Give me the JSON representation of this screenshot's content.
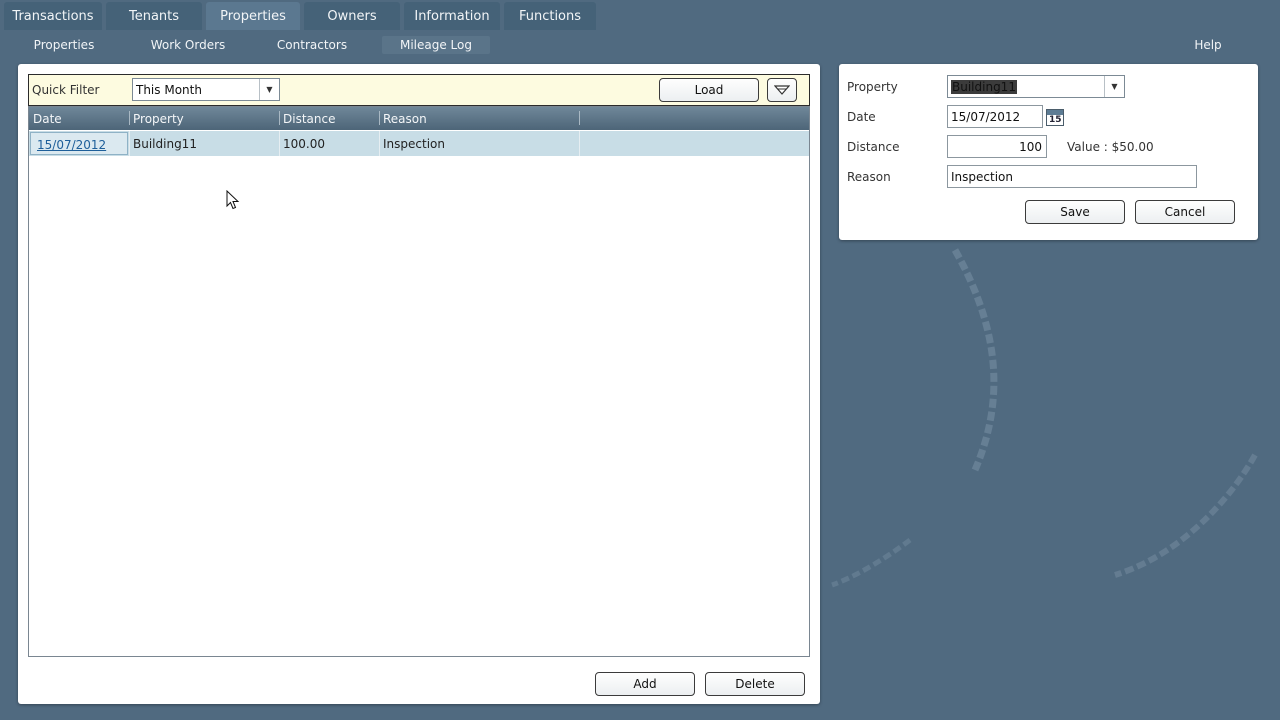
{
  "top_tabs": [
    "Transactions",
    "Tenants",
    "Properties",
    "Owners",
    "Information",
    "Functions"
  ],
  "sub_nav": {
    "items": [
      "Properties",
      "Work Orders",
      "Contractors",
      "Mileage Log"
    ],
    "help": "Help"
  },
  "filter": {
    "label": "Quick Filter",
    "value": "This Month",
    "load_label": "Load"
  },
  "grid": {
    "columns": [
      "Date",
      "Property",
      "Distance",
      "Reason"
    ],
    "rows": [
      {
        "date": "15/07/2012",
        "property": "Building11",
        "distance": "100.00",
        "reason": "Inspection"
      }
    ]
  },
  "actions": {
    "add_label": "Add",
    "delete_label": "Delete"
  },
  "form": {
    "property_label": "Property",
    "property_value": "Building11",
    "date_label": "Date",
    "date_value": "15/07/2012",
    "calendar_day": "15",
    "distance_label": "Distance",
    "distance_value": "100",
    "value_text": "Value : $50.00",
    "reason_label": "Reason",
    "reason_value": "Inspection",
    "save_label": "Save",
    "cancel_label": "Cancel"
  },
  "colors": {
    "background": "#506a80",
    "filter_bar": "#fdfbe0",
    "selected_row": "#c8dde6",
    "link": "#1e5f9a"
  }
}
